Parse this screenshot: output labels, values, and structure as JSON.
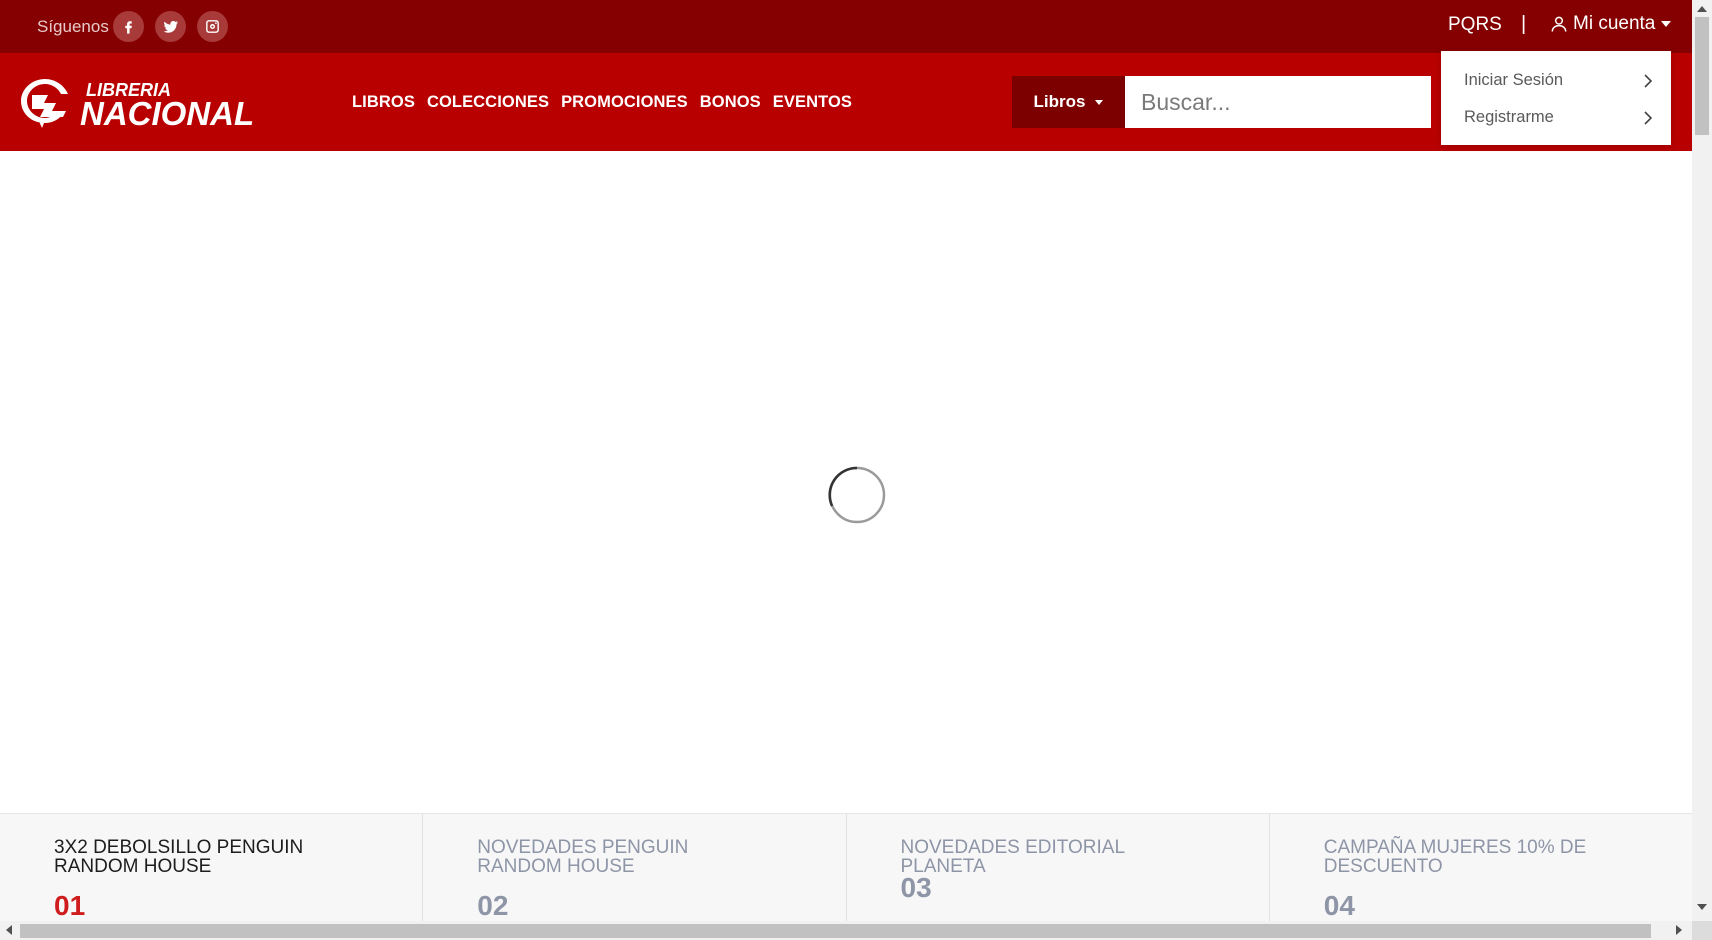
{
  "topbar": {
    "follow_label": "Síguenos",
    "social": [
      {
        "icon": "facebook-icon"
      },
      {
        "icon": "twitter-icon"
      },
      {
        "icon": "instagram-icon"
      }
    ],
    "pqrs_label": "PQRS",
    "separator": "|",
    "account_label": "Mi cuenta"
  },
  "header": {
    "logo_top": "LIBRERIA",
    "logo_bottom": "NACIONAL",
    "nav": [
      "LIBROS",
      "COLECCIONES",
      "PROMOCIONES",
      "BONOS",
      "EVENTOS"
    ],
    "category_label": "Libros",
    "search_placeholder": "Buscar..."
  },
  "account_menu": {
    "items": [
      "Iniciar Sesión",
      "Registrarme"
    ]
  },
  "tabs": [
    {
      "title": "3X2 DEBOLSILLO PENGUIN RANDOM HOUSE",
      "number": "01",
      "active": true
    },
    {
      "title": "NOVEDADES PENGUIN RANDOM HOUSE",
      "number": "02",
      "active": false
    },
    {
      "title": "NOVEDADES EDITORIAL PLANETA",
      "number": "03",
      "active": false
    },
    {
      "title": "CAMPAÑA MUJERES 10% DE DESCUENTO",
      "number": "04",
      "active": false
    }
  ],
  "colors": {
    "topbar": "#850000",
    "header": "#b80000",
    "category_button": "#7d0000",
    "active_number": "#cf1d1d"
  }
}
